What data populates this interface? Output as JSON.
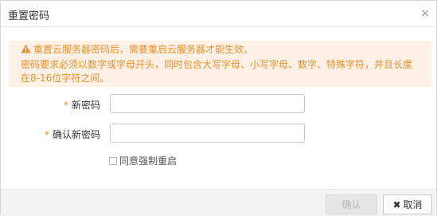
{
  "dialog": {
    "title": "重置密码",
    "close_icon": "×"
  },
  "warning": {
    "icon": "warning-triangle-icon",
    "line1": "重置云服务器密码后，需要重启云服务器才能生效。",
    "line2": "密码要求必须以数字或字母开头，同时包含大写字母、小写字母、数字、特殊字符，并且长度",
    "line3": "在8-16位字符之间。",
    "color": "#e8912b",
    "background": "#fdf0e4"
  },
  "form": {
    "required_mark": "*",
    "new_password_label": "新密码",
    "new_password_value": "",
    "confirm_password_label": "确认新密码",
    "confirm_password_value": "",
    "force_restart_label": "同意强制重启",
    "force_restart_checked": false
  },
  "footer": {
    "confirm_label": "确认",
    "cancel_label": "取消",
    "cancel_icon": "✖"
  }
}
